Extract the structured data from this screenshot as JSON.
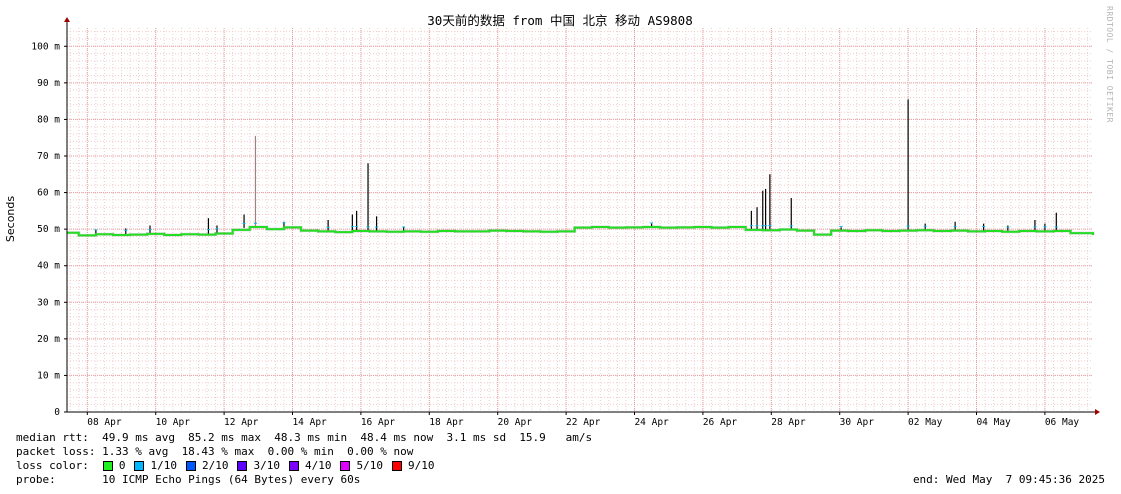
{
  "chart_data": {
    "type": "line",
    "title": "30天前的数据 from 中国 北京 移动 AS9808",
    "ylabel": "Seconds",
    "xlabel": "",
    "ylim": [
      0,
      105
    ],
    "y_unit": "ms",
    "y_ticks": [
      {
        "value": 0,
        "label": "0"
      },
      {
        "value": 10,
        "label": "10 m"
      },
      {
        "value": 20,
        "label": "20 m"
      },
      {
        "value": 30,
        "label": "30 m"
      },
      {
        "value": 40,
        "label": "40 m"
      },
      {
        "value": 50,
        "label": "50 m"
      },
      {
        "value": 60,
        "label": "60 m"
      },
      {
        "value": 70,
        "label": "70 m"
      },
      {
        "value": 80,
        "label": "80 m"
      },
      {
        "value": 90,
        "label": "90 m"
      },
      {
        "value": 100,
        "label": "100 m"
      }
    ],
    "x_range": [
      "2025-04-07 09:45",
      "2025-05-07 09:45"
    ],
    "x_ticks": [
      "08 Apr",
      "10 Apr",
      "12 Apr",
      "14 Apr",
      "16 Apr",
      "18 Apr",
      "20 Apr",
      "22 Apr",
      "24 Apr",
      "26 Apr",
      "28 Apr",
      "30 Apr",
      "02 May",
      "04 May",
      "06 May"
    ],
    "grid": true,
    "series": [
      {
        "name": "median rtt",
        "color": "#22dd22",
        "points": [
          [
            "2025-04-07 09:45",
            49.0
          ],
          [
            "2025-04-07 18:00",
            48.3
          ],
          [
            "2025-04-08 06:00",
            48.6
          ],
          [
            "2025-04-08 18:00",
            48.4
          ],
          [
            "2025-04-09 06:00",
            48.5
          ],
          [
            "2025-04-09 18:00",
            48.7
          ],
          [
            "2025-04-10 06:00",
            48.4
          ],
          [
            "2025-04-10 18:00",
            48.6
          ],
          [
            "2025-04-11 06:00",
            48.5
          ],
          [
            "2025-04-11 18:00",
            48.8
          ],
          [
            "2025-04-12 06:00",
            49.8
          ],
          [
            "2025-04-12 18:00",
            50.6
          ],
          [
            "2025-04-13 06:00",
            50.0
          ],
          [
            "2025-04-13 18:00",
            50.5
          ],
          [
            "2025-04-14 06:00",
            49.6
          ],
          [
            "2025-04-14 18:00",
            49.4
          ],
          [
            "2025-04-15 06:00",
            49.2
          ],
          [
            "2025-04-15 18:00",
            49.5
          ],
          [
            "2025-04-16 06:00",
            49.4
          ],
          [
            "2025-04-16 18:00",
            49.3
          ],
          [
            "2025-04-17 06:00",
            49.4
          ],
          [
            "2025-04-17 18:00",
            49.3
          ],
          [
            "2025-04-18 06:00",
            49.5
          ],
          [
            "2025-04-18 18:00",
            49.4
          ],
          [
            "2025-04-19 06:00",
            49.4
          ],
          [
            "2025-04-19 18:00",
            49.6
          ],
          [
            "2025-04-20 06:00",
            49.5
          ],
          [
            "2025-04-20 18:00",
            49.4
          ],
          [
            "2025-04-21 06:00",
            49.3
          ],
          [
            "2025-04-21 18:00",
            49.4
          ],
          [
            "2025-04-22 06:00",
            50.4
          ],
          [
            "2025-04-22 18:00",
            50.6
          ],
          [
            "2025-04-23 06:00",
            50.4
          ],
          [
            "2025-04-23 18:00",
            50.5
          ],
          [
            "2025-04-24 06:00",
            50.6
          ],
          [
            "2025-04-24 18:00",
            50.4
          ],
          [
            "2025-04-25 06:00",
            50.5
          ],
          [
            "2025-04-25 18:00",
            50.6
          ],
          [
            "2025-04-26 06:00",
            50.4
          ],
          [
            "2025-04-26 18:00",
            50.6
          ],
          [
            "2025-04-27 06:00",
            49.8
          ],
          [
            "2025-04-27 18:00",
            49.7
          ],
          [
            "2025-04-28 06:00",
            49.9
          ],
          [
            "2025-04-28 18:00",
            49.6
          ],
          [
            "2025-04-29 06:00",
            48.5
          ],
          [
            "2025-04-29 18:00",
            49.6
          ],
          [
            "2025-04-30 06:00",
            49.5
          ],
          [
            "2025-04-30 18:00",
            49.7
          ],
          [
            "2025-05-01 06:00",
            49.5
          ],
          [
            "2025-05-01 18:00",
            49.6
          ],
          [
            "2025-05-02 06:00",
            49.7
          ],
          [
            "2025-05-02 18:00",
            49.5
          ],
          [
            "2025-05-03 06:00",
            49.6
          ],
          [
            "2025-05-03 18:00",
            49.4
          ],
          [
            "2025-05-04 06:00",
            49.5
          ],
          [
            "2025-05-04 18:00",
            49.3
          ],
          [
            "2025-05-05 06:00",
            49.5
          ],
          [
            "2025-05-05 18:00",
            49.4
          ],
          [
            "2025-05-06 06:00",
            49.5
          ],
          [
            "2025-05-06 18:00",
            48.9
          ],
          [
            "2025-05-07 09:45",
            48.4
          ]
        ]
      }
    ],
    "spikes": [
      [
        "2025-04-08 06:00",
        49.8
      ],
      [
        "2025-04-09 03:00",
        50.2
      ],
      [
        "2025-04-09 20:00",
        51.0
      ],
      [
        "2025-04-11 13:00",
        53.0
      ],
      [
        "2025-04-11 19:00",
        51.0
      ],
      [
        "2025-04-12 14:00",
        54.0
      ],
      [
        "2025-04-12 22:00",
        75.5
      ],
      [
        "2025-04-13 18:00",
        52.0
      ],
      [
        "2025-04-15 01:00",
        52.5
      ],
      [
        "2025-04-15 18:00",
        54.0
      ],
      [
        "2025-04-15 21:00",
        55.0
      ],
      [
        "2025-04-16 05:00",
        68.0
      ],
      [
        "2025-04-16 11:00",
        53.5
      ],
      [
        "2025-04-17 06:00",
        50.5
      ],
      [
        "2025-04-24 12:00",
        51.5
      ],
      [
        "2025-04-27 10:00",
        55.0
      ],
      [
        "2025-04-27 14:00",
        56.0
      ],
      [
        "2025-04-27 18:00",
        60.5
      ],
      [
        "2025-04-27 20:00",
        61.0
      ],
      [
        "2025-04-27 23:00",
        65.0
      ],
      [
        "2025-04-28 14:00",
        58.5
      ],
      [
        "2025-04-30 01:00",
        50.5
      ],
      [
        "2025-05-02 00:00",
        85.5
      ],
      [
        "2025-05-02 12:00",
        51.5
      ],
      [
        "2025-05-03 09:00",
        52.0
      ],
      [
        "2025-05-04 05:00",
        51.5
      ],
      [
        "2025-05-04 22:00",
        51.0
      ],
      [
        "2025-05-05 17:00",
        52.5
      ],
      [
        "2025-05-06 00:00",
        51.5
      ],
      [
        "2025-05-06 08:00",
        54.5
      ]
    ]
  },
  "stats": {
    "median_rtt": "median rtt:  49.9 ms avg  85.2 ms max  48.3 ms min  48.4 ms now  3.1 ms sd  15.9   am/s",
    "packet_loss": "packet loss: 1.33 % avg  18.43 % max  0.00 % min  0.00 % now"
  },
  "legend": {
    "label": "loss color:",
    "items": [
      {
        "label": "0",
        "color": "#22ee22"
      },
      {
        "label": "1/10",
        "color": "#00b8ff"
      },
      {
        "label": "2/10",
        "color": "#0059ff"
      },
      {
        "label": "3/10",
        "color": "#5e00ff"
      },
      {
        "label": "4/10",
        "color": "#7e00ff"
      },
      {
        "label": "5/10",
        "color": "#dd00ff"
      },
      {
        "label": "9/10",
        "color": "#ff0000"
      }
    ]
  },
  "probe": "probe:       10 ICMP Echo Pings (64 Bytes) every 60s",
  "end": "end: Wed May  7 09:45:36 2025",
  "credit": "RRDTOOL / TOBI OETIKER",
  "colors": {
    "grid_major": "#e8a0a0",
    "grid_minor": "#f2cccc",
    "axis": "#000000",
    "arrow": "#a00000"
  }
}
